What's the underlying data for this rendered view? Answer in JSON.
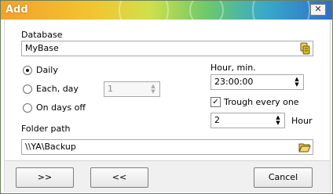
{
  "window": {
    "title": "Add",
    "close_label": "✕"
  },
  "database": {
    "label": "Database",
    "value": "MyBase"
  },
  "schedule": {
    "daily_label": "Daily",
    "daily_checked": true,
    "each_day_label": "Each, day",
    "each_day_value": "1",
    "on_days_off_label": "On days off"
  },
  "hour": {
    "label": "Hour, min.",
    "value": "23:00:00"
  },
  "trough": {
    "label": "Trough every one",
    "checked": true,
    "value": "2",
    "unit": "Hour"
  },
  "folder": {
    "label": "Folder path",
    "value": "\\\\YA\\Backup"
  },
  "buttons": {
    "next": ">>",
    "back": "<<",
    "cancel": "Cancel"
  }
}
